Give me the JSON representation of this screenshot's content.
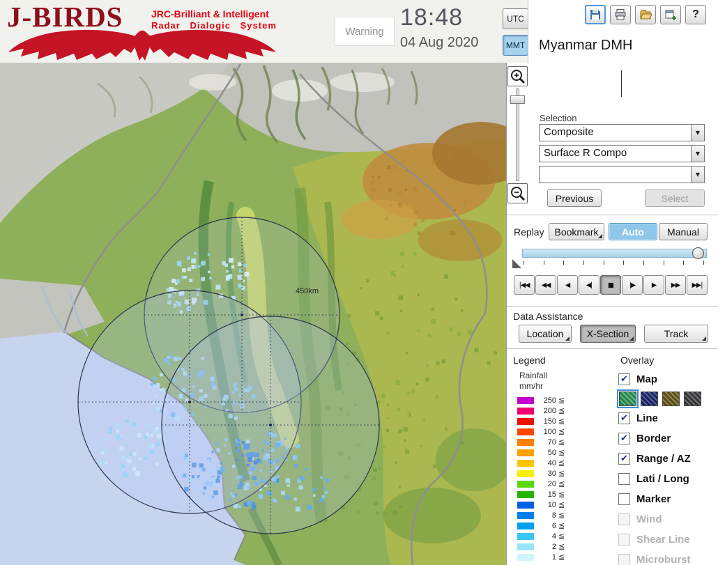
{
  "header": {
    "logo": {
      "title": "J-BIRDS",
      "tagline_line1": "JRC-Brilliant & Intelligent",
      "tagline_line2": "Radar Dialogic System"
    },
    "warning_label": "Warning",
    "clock": {
      "time": "18:48",
      "date": "04 Aug 2020"
    },
    "timezone": {
      "utc_label": "UTC",
      "mmt_label": "MMT",
      "selected": "MMT"
    },
    "station_name": "Myanmar DMH",
    "toolbar_icons": [
      "save",
      "print",
      "open",
      "add-view",
      "help"
    ],
    "help_glyph": "?"
  },
  "map": {
    "range_label": "450km"
  },
  "selection": {
    "label": "Selection",
    "arrow_glyph": "▼",
    "dropdowns": [
      {
        "value": "Composite"
      },
      {
        "value": "Surface R Compo"
      },
      {
        "value": ""
      }
    ],
    "previous_label": "Previous",
    "select_label": "Select"
  },
  "replay": {
    "label": "Replay",
    "bookmark_label": "Bookmark",
    "auto_label": "Auto",
    "manual_label": "Manual",
    "active_mode": "Auto",
    "slider_position_pct": 98,
    "transport": [
      {
        "glyph": "|◀◀",
        "pressed": false
      },
      {
        "glyph": "◀◀",
        "pressed": false
      },
      {
        "glyph": "◀",
        "pressed": false
      },
      {
        "glyph": "◀|",
        "pressed": false
      },
      {
        "glyph": "■",
        "pressed": true
      },
      {
        "glyph": "|▶",
        "pressed": false
      },
      {
        "glyph": "▶",
        "pressed": false
      },
      {
        "glyph": "▶▶",
        "pressed": false
      },
      {
        "glyph": "▶▶|",
        "pressed": false
      }
    ]
  },
  "data_assistance": {
    "label": "Data Assistance",
    "buttons": [
      {
        "label": "Location",
        "pressed": false
      },
      {
        "label": "X-Section",
        "pressed": true
      },
      {
        "label": "Track",
        "pressed": false
      }
    ]
  },
  "legend": {
    "label": "Legend",
    "unit_line1": "Rainfall",
    "unit_line2": "mm/hr",
    "lte_glyph": "≦",
    "entries": [
      {
        "value": "250",
        "color": "#c400cc"
      },
      {
        "value": "200",
        "color": "#f0006e"
      },
      {
        "value": "150",
        "color": "#ee1000"
      },
      {
        "value": "100",
        "color": "#ff4600"
      },
      {
        "value": "70",
        "color": "#ff7d00"
      },
      {
        "value": "50",
        "color": "#ffa000"
      },
      {
        "value": "40",
        "color": "#ffc400"
      },
      {
        "value": "30",
        "color": "#f8ee00"
      },
      {
        "value": "20",
        "color": "#5cd600"
      },
      {
        "value": "15",
        "color": "#25b400"
      },
      {
        "value": "10",
        "color": "#0060e0"
      },
      {
        "value": "8",
        "color": "#0080e8"
      },
      {
        "value": "6",
        "color": "#00a0ee"
      },
      {
        "value": "4",
        "color": "#3cc6f4"
      },
      {
        "value": "2",
        "color": "#96e4fa"
      },
      {
        "value": "1",
        "color": "#d2f4ff"
      }
    ]
  },
  "overlay": {
    "label": "Overlay",
    "check_glyph": "✔",
    "map_item": {
      "label": "Map",
      "checked": true,
      "disabled": false
    },
    "map_styles": [
      {
        "color": "#2f9e53",
        "selected": true
      },
      {
        "color": "#1b2a6b",
        "selected": false
      },
      {
        "color": "#6b5a10",
        "selected": false
      },
      {
        "color": "#3e3e3e",
        "selected": false
      }
    ],
    "items": [
      {
        "label": "Line",
        "checked": true,
        "disabled": false
      },
      {
        "label": "Border",
        "checked": true,
        "disabled": false
      },
      {
        "label": "Range / AZ",
        "checked": true,
        "disabled": false
      },
      {
        "label": "Lati / Long",
        "checked": false,
        "disabled": false
      },
      {
        "label": "Marker",
        "checked": false,
        "disabled": false
      },
      {
        "label": "Wind",
        "checked": false,
        "disabled": true
      },
      {
        "label": "Shear Line",
        "checked": false,
        "disabled": true
      },
      {
        "label": "Microburst",
        "checked": false,
        "disabled": true
      }
    ]
  }
}
